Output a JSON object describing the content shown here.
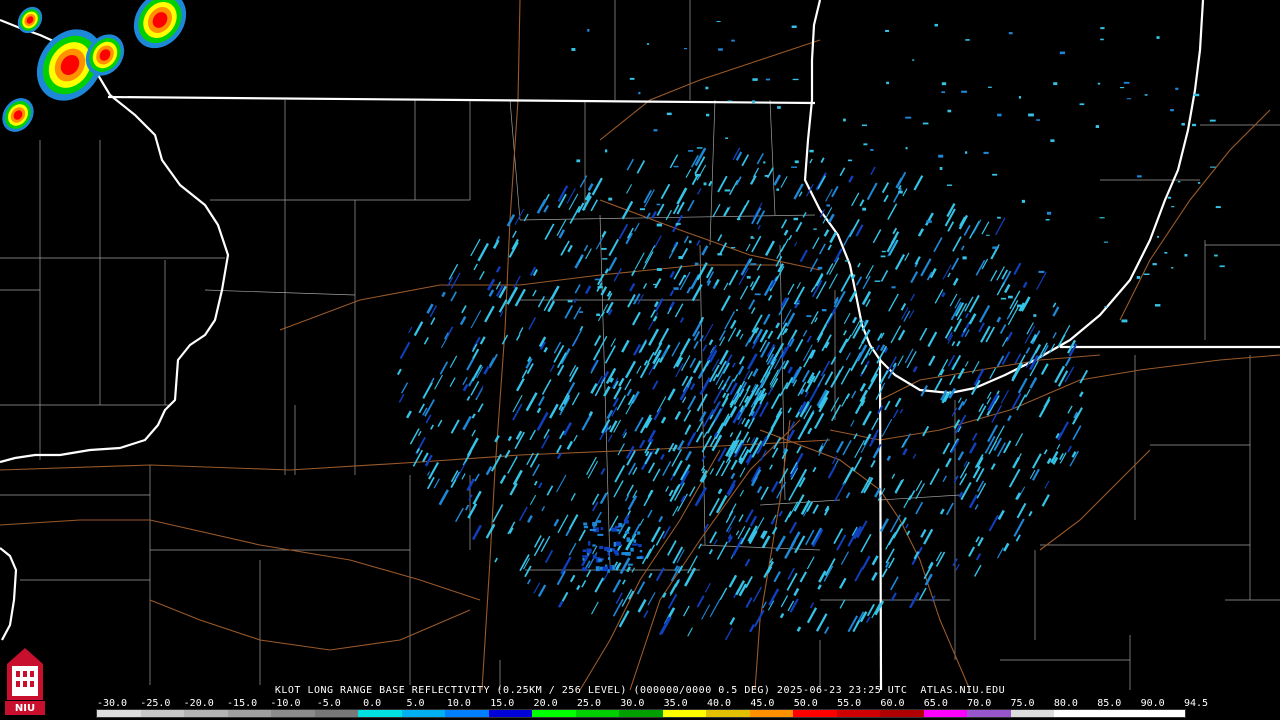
{
  "product": {
    "caption": "KLOT LONG RANGE BASE REFLECTIVITY (0.25KM / 256 LEVEL) (000000/0000 0.5 DEG) 2025-06-23 23:25 UTC  ATLAS.NIU.EDU"
  },
  "logo": {
    "text": "NIU",
    "color": "#c8102e"
  },
  "scale": {
    "labels": [
      "-30.0",
      "-25.0",
      "-20.0",
      "-15.0",
      "-10.0",
      "-5.0",
      "0.0",
      "5.0",
      "10.0",
      "15.0",
      "20.0",
      "25.0",
      "30.0",
      "35.0",
      "40.0",
      "45.0",
      "50.0",
      "55.0",
      "60.0",
      "65.0",
      "70.0",
      "75.0",
      "80.0",
      "85.0",
      "90.0",
      "94.5"
    ],
    "colors": [
      "#dddddd",
      "#c8c8c8",
      "#b4b4b4",
      "#a0a0a0",
      "#8c8c8c",
      "#787878",
      "#00e0e0",
      "#00b0f0",
      "#0080ff",
      "#0000d8",
      "#00ff00",
      "#00d000",
      "#00a000",
      "#ffff00",
      "#e0c000",
      "#ff9000",
      "#ff0000",
      "#d00000",
      "#b00000",
      "#ff00ff",
      "#9955cc",
      "#dddddd",
      "#ffffff",
      "#ffffff",
      "#ffffff"
    ]
  },
  "colors": {
    "state_border": "#ffffff",
    "county": "#a0a0a0",
    "road": "#9a5a2a",
    "echo_light": "#35c4e8",
    "echo_mid": "#1e88d8",
    "echo_dark": "#1040c0"
  }
}
